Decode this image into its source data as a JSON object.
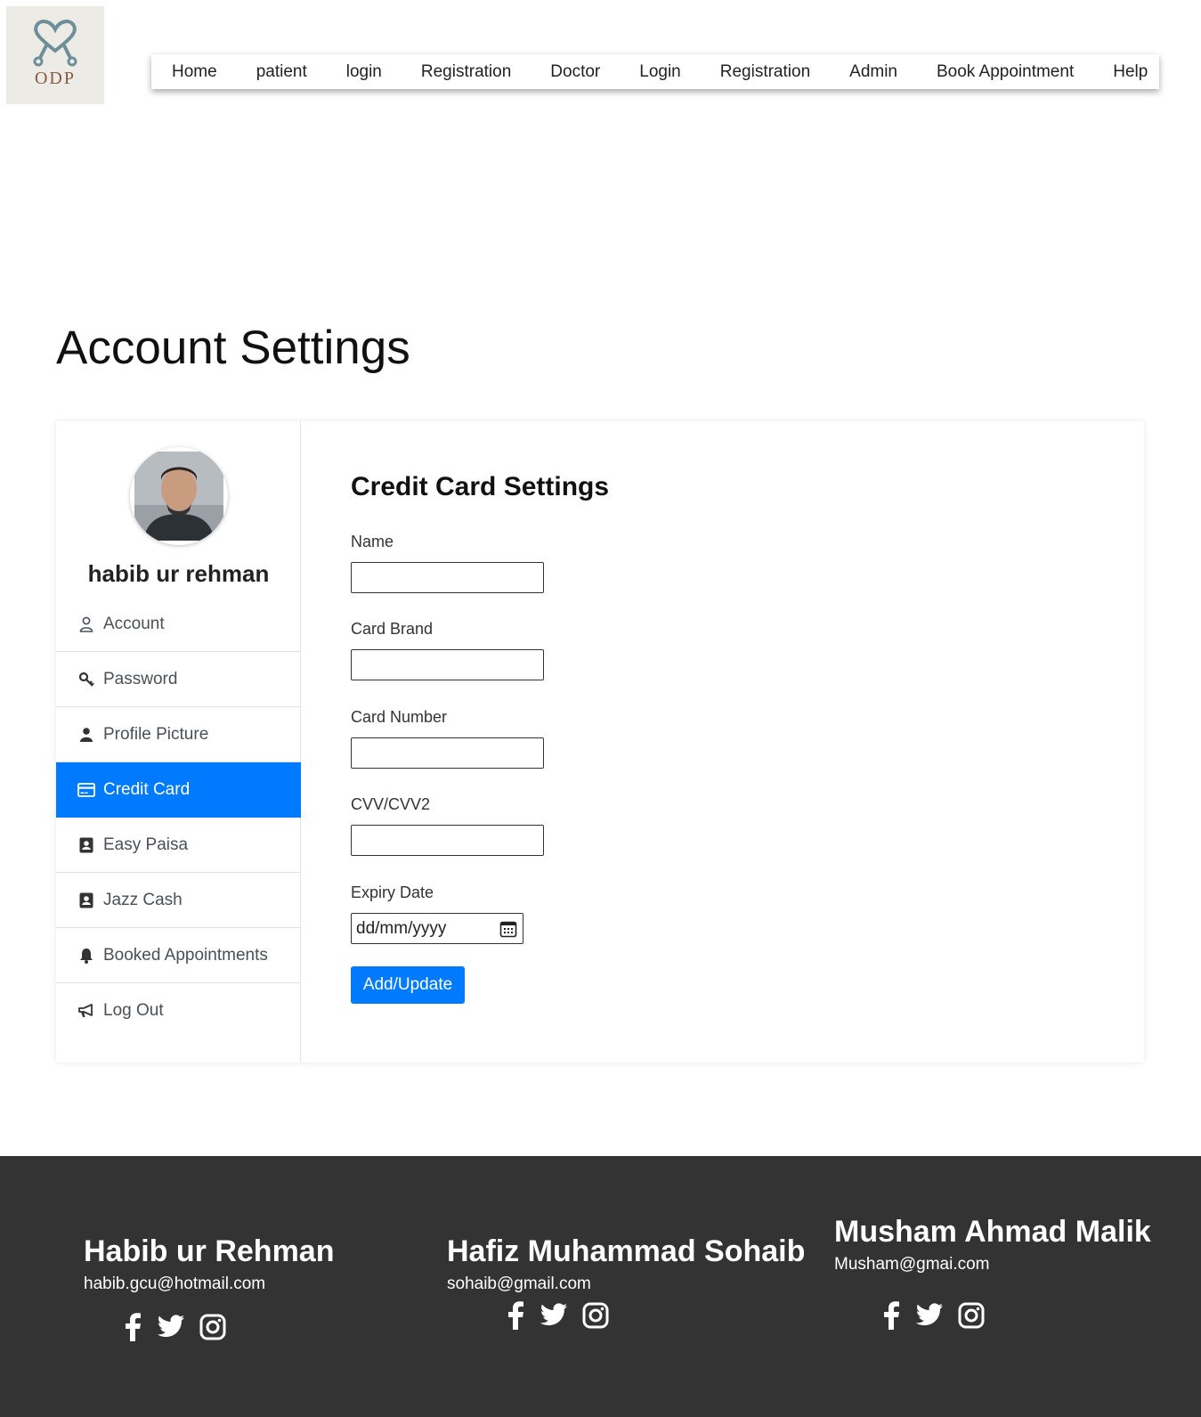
{
  "logo": {
    "text": "ODP",
    "icon": "stethoscope-heart-icon"
  },
  "nav": {
    "items": [
      "Home",
      "patient",
      "login",
      "Registration",
      "Doctor",
      "Login",
      "Registration",
      "Admin",
      "Book Appointment",
      "Help"
    ]
  },
  "page": {
    "title": "Account Settings"
  },
  "profile": {
    "name": "habib ur rehman",
    "avatar_icon": "user-photo-avatar"
  },
  "sidebar": {
    "items": [
      {
        "label": "Account",
        "icon": "user-outline-icon"
      },
      {
        "label": "Password",
        "icon": "key-icon"
      },
      {
        "label": "Profile Picture",
        "icon": "user-solid-icon"
      },
      {
        "label": "Credit Card",
        "icon": "credit-card-icon",
        "active": true
      },
      {
        "label": "Easy Paisa",
        "icon": "address-book-icon"
      },
      {
        "label": "Jazz Cash",
        "icon": "address-book-icon"
      },
      {
        "label": "Booked Appointments",
        "icon": "bell-icon"
      },
      {
        "label": "Log Out",
        "icon": "bullhorn-icon"
      }
    ]
  },
  "form": {
    "title": "Credit Card Settings",
    "fields": [
      {
        "label": "Name",
        "value": ""
      },
      {
        "label": "Card Brand",
        "value": ""
      },
      {
        "label": "Card Number",
        "value": ""
      },
      {
        "label": "CVV/CVV2",
        "value": ""
      }
    ],
    "expiry": {
      "label": "Expiry Date",
      "placeholder": "dd/mm/yyyy"
    },
    "submit_label": "Add/Update"
  },
  "footer": {
    "authors": [
      {
        "name": "Habib ur Rehman",
        "email": "habib.gcu@hotmail.com"
      },
      {
        "name": "Hafiz Muhammad Sohaib",
        "email": "sohaib@gmail.com"
      },
      {
        "name": "Musham Ahmad Malik",
        "email": "Musham@gmai.com"
      }
    ],
    "social_icons": [
      "facebook-icon",
      "twitter-icon",
      "instagram-icon"
    ]
  },
  "colors": {
    "accent": "#007bff",
    "footer_bg": "#333333",
    "logo_bg": "#ecebe6"
  }
}
